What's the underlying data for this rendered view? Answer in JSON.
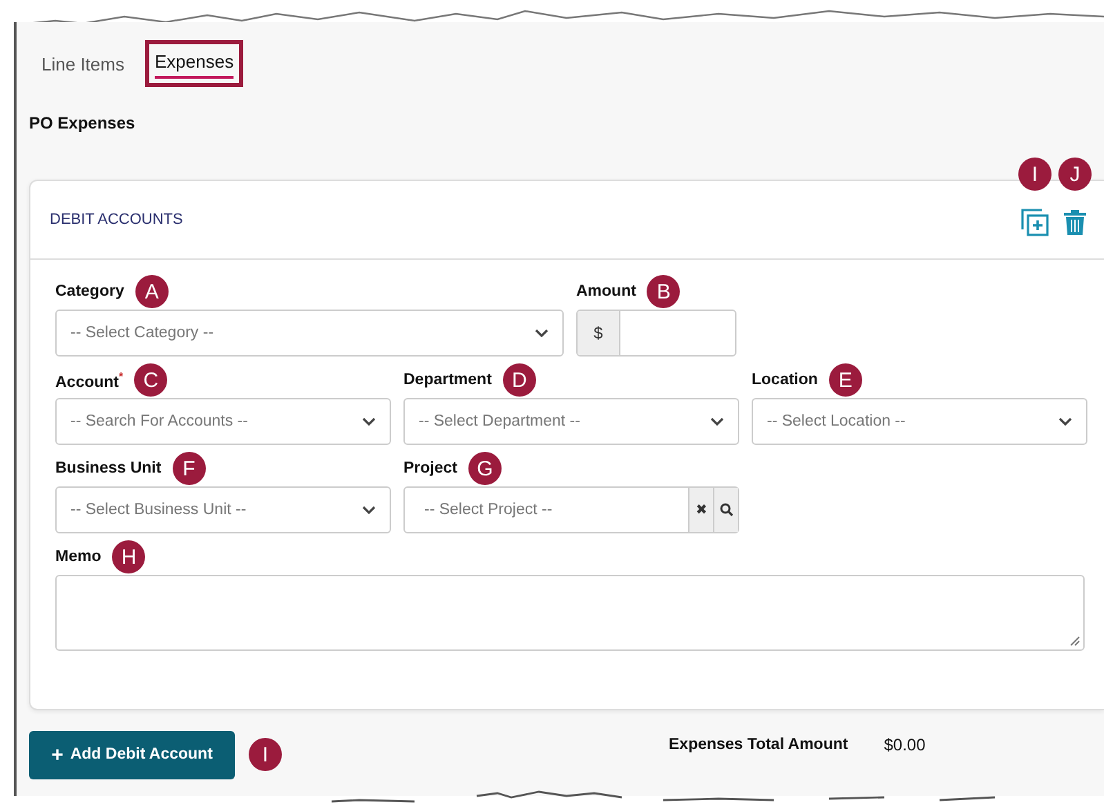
{
  "tabs": [
    {
      "label": "Line Items",
      "selected": false
    },
    {
      "label": "Expenses",
      "selected": true
    }
  ],
  "section_title": "PO Expenses",
  "card": {
    "title": "DEBIT ACCOUNTS",
    "actions": [
      {
        "kind": "copy",
        "marker": "I"
      },
      {
        "kind": "delete",
        "marker": "J"
      }
    ],
    "rows": [
      [
        {
          "label": "Category",
          "marker": "A",
          "kind": "select",
          "placeholder": "-- Select Category --"
        },
        {
          "label": "Amount",
          "marker": "B",
          "kind": "amount",
          "prefix": "$"
        }
      ],
      [
        {
          "label": "Account",
          "required_mark": "*",
          "marker": "C",
          "kind": "select",
          "placeholder": "-- Search For Accounts --"
        },
        {
          "label": "Department",
          "marker": "D",
          "kind": "select",
          "placeholder": "-- Select Department --"
        },
        {
          "label": "Location",
          "marker": "E",
          "kind": "select",
          "placeholder": "-- Select Location --"
        }
      ],
      [
        {
          "label": "Business Unit",
          "marker": "F",
          "kind": "select",
          "placeholder": "-- Select Business Unit --"
        },
        {
          "label": "Project",
          "marker": "G",
          "kind": "lookup",
          "placeholder": "-- Select Project --",
          "clear": "✖"
        }
      ],
      [
        {
          "label": "Memo",
          "marker": "H",
          "kind": "textarea"
        }
      ]
    ]
  },
  "footer": {
    "button": {
      "label": "Add Debit Account",
      "icon": "+",
      "marker": "I"
    },
    "total_label": "Expenses Total Amount",
    "total_value": "$0.00"
  }
}
